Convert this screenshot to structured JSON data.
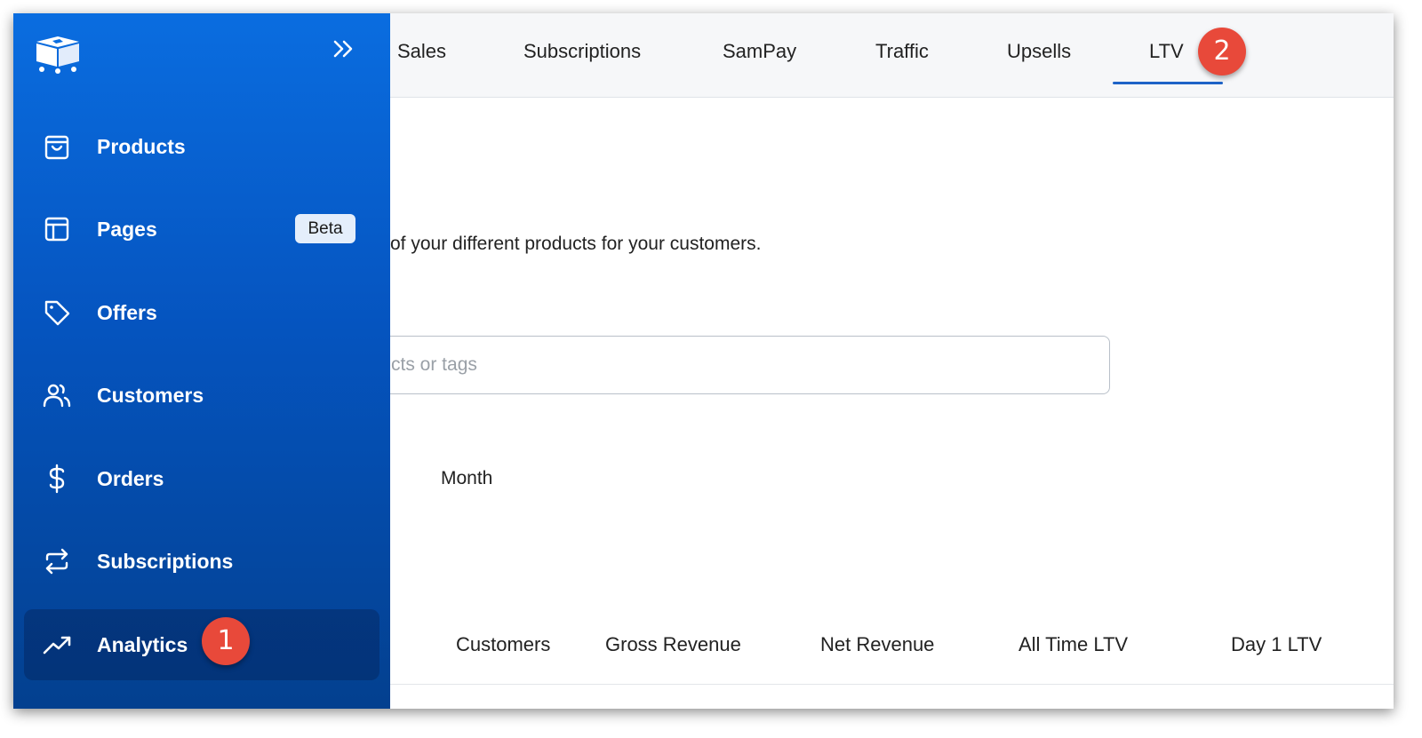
{
  "topnav": {
    "tabs": [
      "Sales",
      "Subscriptions",
      "SamPay",
      "Traffic",
      "Upsells",
      "LTV"
    ],
    "active_tab": "LTV"
  },
  "main": {
    "description": "of your different products for your customers.",
    "search_placeholder": "cts or tags",
    "period_label": "Month",
    "columns": [
      "Customers",
      "Gross Revenue",
      "Net Revenue",
      "All Time LTV",
      "Day 1 LTV"
    ]
  },
  "sidebar": {
    "items": [
      {
        "label": "Products",
        "icon": "shopping-bag-icon"
      },
      {
        "label": "Pages",
        "icon": "layout-icon",
        "badge": "Beta"
      },
      {
        "label": "Offers",
        "icon": "tag-icon"
      },
      {
        "label": "Customers",
        "icon": "users-icon"
      },
      {
        "label": "Orders",
        "icon": "dollar-icon"
      },
      {
        "label": "Subscriptions",
        "icon": "repeat-icon"
      },
      {
        "label": "Analytics",
        "icon": "trending-up-icon",
        "active": true
      }
    ]
  },
  "callouts": [
    "1",
    "2"
  ],
  "colors": {
    "sidebar_top": "#0a6de0",
    "sidebar_bottom": "#03408f",
    "accent": "#1e63c7",
    "callout": "#e8493a"
  }
}
